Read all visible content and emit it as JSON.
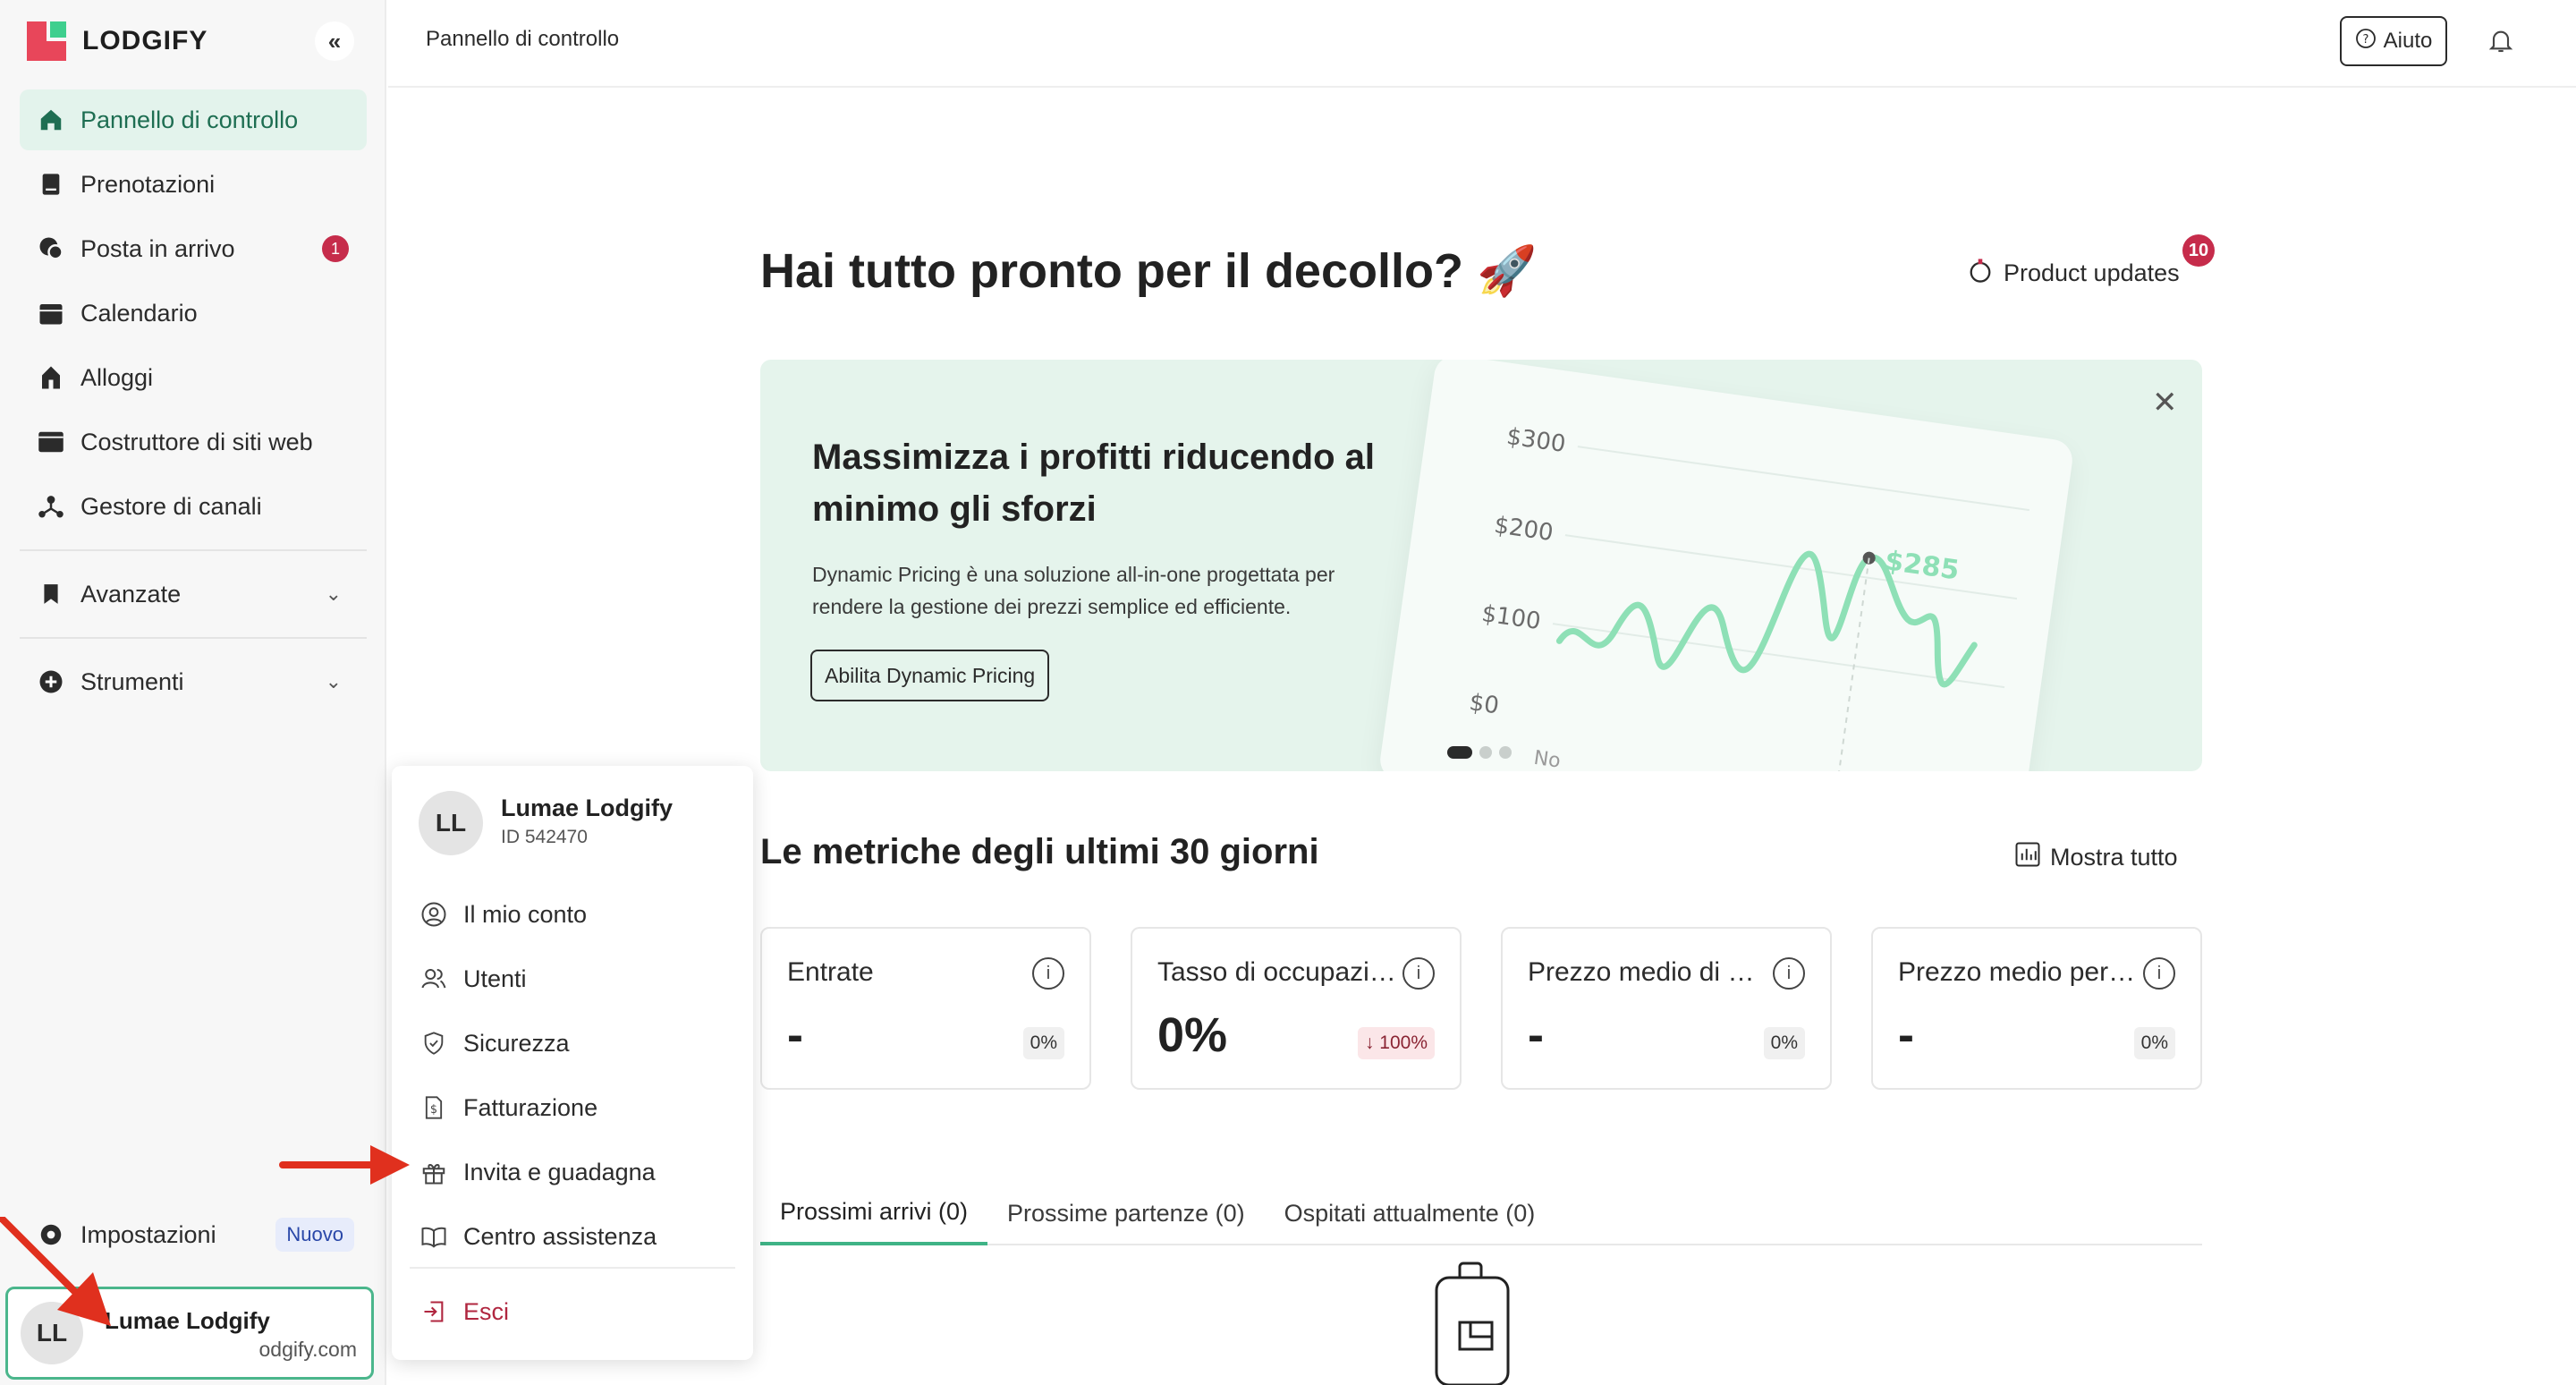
{
  "brand": {
    "name": "LODGIFY",
    "colors": {
      "accent": "#3fb386",
      "brand_red": "#e8465a",
      "badge": "#c62c4b",
      "annotation_arrow": "#e0301e"
    }
  },
  "sidebar": {
    "collapse_icon": "double-chevron-left-icon",
    "items": [
      {
        "label": "Pannello di controllo",
        "icon": "home-icon",
        "active": true
      },
      {
        "label": "Prenotazioni",
        "icon": "book-icon"
      },
      {
        "label": "Posta in arrivo",
        "icon": "chat-icon",
        "badge": "1"
      },
      {
        "label": "Calendario",
        "icon": "calendar-icon"
      },
      {
        "label": "Alloggi",
        "icon": "house-icon"
      },
      {
        "label": "Costruttore di siti web",
        "icon": "browser-icon"
      },
      {
        "label": "Gestore di canali",
        "icon": "network-icon"
      }
    ],
    "groups": [
      {
        "label": "Avanzate",
        "icon": "bookmark-icon"
      },
      {
        "label": "Strumenti",
        "icon": "plus-circle-icon"
      }
    ],
    "settings": {
      "label": "Impostazioni",
      "badge": "Nuovo",
      "icon": "gear-icon"
    },
    "user": {
      "initials": "LL",
      "name": "Lumae Lodgify",
      "email_fragment": "odgify.com"
    }
  },
  "topbar": {
    "breadcrumb": "Pannello di controllo",
    "help_label": "Aiuto"
  },
  "hero": {
    "title": "Hai tutto pronto per il decollo? 🚀",
    "updates_label": "Product updates",
    "updates_count": "10"
  },
  "banner": {
    "title": "Massimizza i profitti riducendo al minimo gli sforzi",
    "description": "Dynamic Pricing è una soluzione all-in-one progettata per rendere la gestione dei prezzi semplice ed efficiente.",
    "button": "Abilita Dynamic Pricing",
    "illustration": {
      "y_ticks": [
        "$300",
        "$200",
        "$100",
        "$0"
      ],
      "highlight": "$285",
      "x_fragment": "No"
    },
    "carousel": {
      "count": 3,
      "active": 0
    }
  },
  "metrics": {
    "title": "Le metriche degli ultimi 30 giorni",
    "show_all": "Mostra tutto",
    "cards": [
      {
        "label": "Entrate",
        "value": "-",
        "delta": "0%",
        "negative": false
      },
      {
        "label": "Tasso di occupazione",
        "value": "0%",
        "delta": "↓ 100%",
        "negative": true
      },
      {
        "label": "Prezzo medio di notte",
        "value": "-",
        "delta": "0%",
        "negative": false
      },
      {
        "label": "Prezzo medio per prenotazione",
        "value": "-",
        "delta": "0%",
        "negative": false
      }
    ]
  },
  "tabs": [
    {
      "label": "Prossimi arrivi (0)",
      "active": true
    },
    {
      "label": "Prossime partenze (0)"
    },
    {
      "label": "Ospitati attualmente (0)"
    }
  ],
  "user_menu": {
    "initials": "LL",
    "name": "Lumae Lodgify",
    "id": "ID 542470",
    "items": [
      {
        "label": "Il mio conto",
        "icon": "user-circle-icon"
      },
      {
        "label": "Utenti",
        "icon": "users-icon"
      },
      {
        "label": "Sicurezza",
        "icon": "shield-icon"
      },
      {
        "label": "Fatturazione",
        "icon": "invoice-icon"
      },
      {
        "label": "Invita e guadagna",
        "icon": "gift-icon"
      },
      {
        "label": "Centro assistenza",
        "icon": "open-book-icon"
      }
    ],
    "exit": "Esci"
  }
}
